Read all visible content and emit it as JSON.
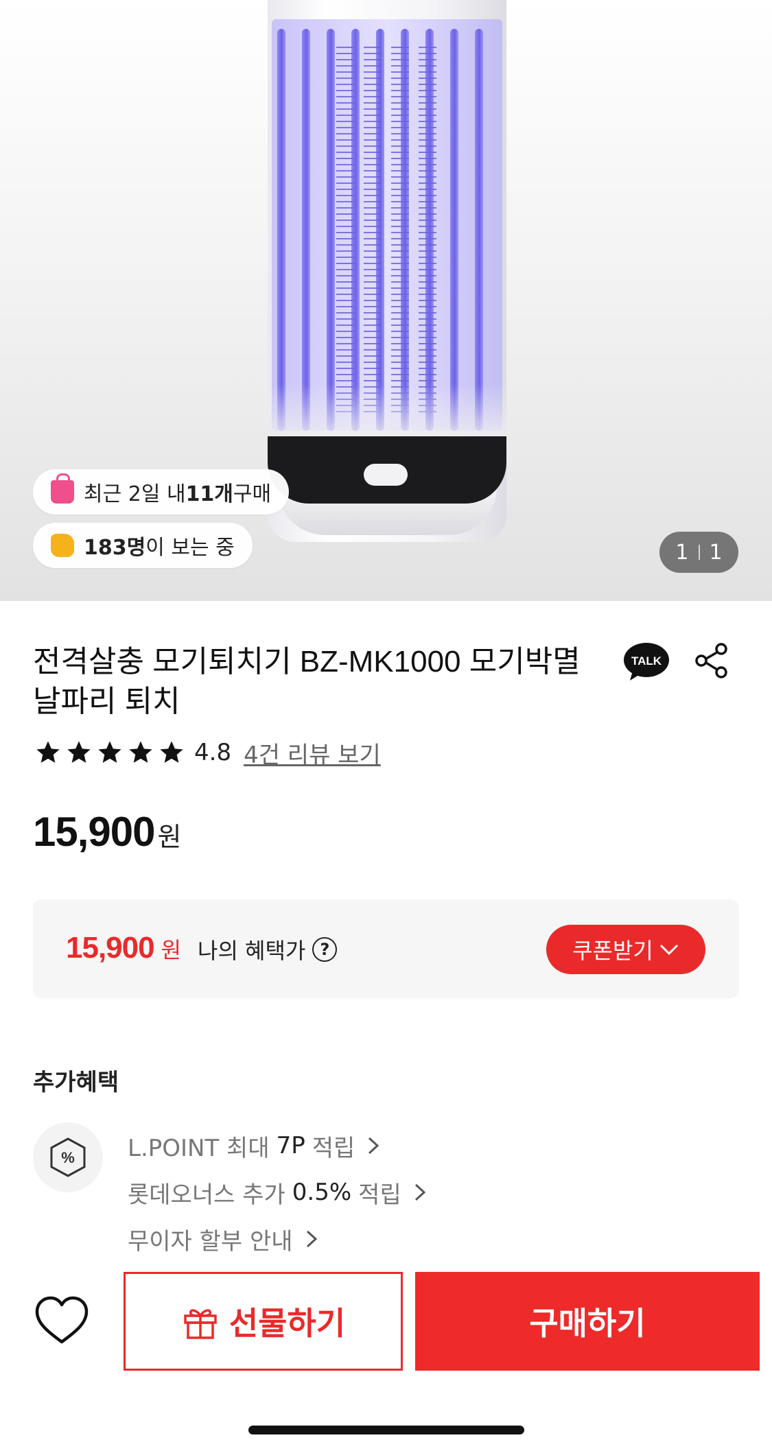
{
  "hero": {
    "social_proof": [
      {
        "icon": "shopping-bag-icon",
        "prefix": "최근 2일 내 ",
        "bold": "11개",
        "suffix": " 구매"
      },
      {
        "icon": "thumbs-up-icon",
        "prefix": "",
        "bold": "183명",
        "suffix": "이 보는 중"
      }
    ],
    "image_counter": {
      "current": "1",
      "total": "1"
    }
  },
  "product": {
    "title": "전격살충 모기퇴치기 BZ-MK1000 모기박멸 날파리 퇴치",
    "talk_icon_label": "TALK",
    "rating": {
      "stars": 5,
      "score": "4.8",
      "review_link": "4건 리뷰 보기"
    },
    "price": {
      "value": "15,900",
      "unit": "원"
    }
  },
  "benefit": {
    "price": "15,900",
    "unit": "원",
    "label": "나의 혜택가",
    "help_symbol": "?",
    "coupon_button": "쿠폰받기"
  },
  "extra_benefits": {
    "title": "추가혜택",
    "badge_symbol": "%",
    "items": [
      {
        "prefix": "L.POINT 최대",
        "highlight": "7P",
        "suffix": "적립"
      },
      {
        "prefix": "롯데오너스 추가",
        "highlight": "0.5%",
        "suffix": "적립"
      },
      {
        "prefix": "무이자 할부 안내",
        "highlight": "",
        "suffix": ""
      }
    ]
  },
  "bottom_bar": {
    "gift_button": "선물하기",
    "buy_button": "구매하기"
  },
  "colors": {
    "accent": "#ea2a2a",
    "star": "#111111",
    "pill_bg": "#ffffff",
    "counter_bg": "#505050"
  }
}
